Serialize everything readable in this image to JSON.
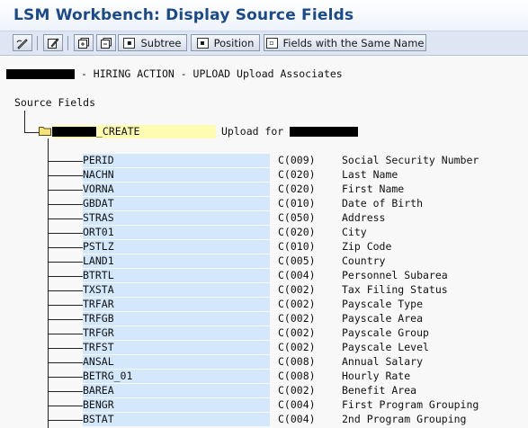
{
  "window": {
    "title": "LSM Workbench: Display Source Fields"
  },
  "toolbar": {
    "buttons": [
      {
        "name": "edit-icon"
      },
      {
        "name": "pencil-icon"
      },
      {
        "name": "expand-icon"
      },
      {
        "name": "collapse-icon"
      }
    ],
    "subtree_label": "Subtree",
    "position_label": "Position",
    "same_name_label": "Fields with the Same Name"
  },
  "heading": {
    "text": "- HIRING ACTION - UPLOAD Upload Associates"
  },
  "tree": {
    "section_label": "Source Fields",
    "root": {
      "name_suffix": "_CREATE",
      "description": "Upload for"
    },
    "fields": [
      {
        "name": "PERID",
        "type": "C(009)",
        "description": "Social Security Number"
      },
      {
        "name": "NACHN",
        "type": "C(020)",
        "description": "Last Name"
      },
      {
        "name": "VORNA",
        "type": "C(020)",
        "description": "First Name"
      },
      {
        "name": "GBDAT",
        "type": "C(010)",
        "description": "Date of Birth"
      },
      {
        "name": "STRAS",
        "type": "C(050)",
        "description": "Address"
      },
      {
        "name": "ORT01",
        "type": "C(020)",
        "description": "City"
      },
      {
        "name": "PSTLZ",
        "type": "C(010)",
        "description": "Zip Code"
      },
      {
        "name": "LAND1",
        "type": "C(005)",
        "description": "Country"
      },
      {
        "name": "BTRTL",
        "type": "C(004)",
        "description": "Personnel Subarea"
      },
      {
        "name": "TXSTA",
        "type": "C(002)",
        "description": "Tax Filing Status"
      },
      {
        "name": "TRFAR",
        "type": "C(002)",
        "description": "Payscale Type"
      },
      {
        "name": "TRFGB",
        "type": "C(002)",
        "description": "Payscale Area"
      },
      {
        "name": "TRFGR",
        "type": "C(002)",
        "description": "Payscale Group"
      },
      {
        "name": "TRFST",
        "type": "C(002)",
        "description": "Payscale Level"
      },
      {
        "name": "ANSAL",
        "type": "C(008)",
        "description": "Annual Salary"
      },
      {
        "name": "BETRG_01",
        "type": "C(008)",
        "description": "Hourly Rate"
      },
      {
        "name": "BAREA",
        "type": "C(002)",
        "description": "Benefit Area"
      },
      {
        "name": "BENGR",
        "type": "C(004)",
        "description": "First Program Grouping"
      },
      {
        "name": "BSTAT",
        "type": "C(004)",
        "description": "2nd Program Grouping"
      }
    ]
  },
  "colors": {
    "title": "#1a4a8a",
    "field_highlight": "#d4e8fb",
    "root_highlight": "#fefcb0"
  }
}
